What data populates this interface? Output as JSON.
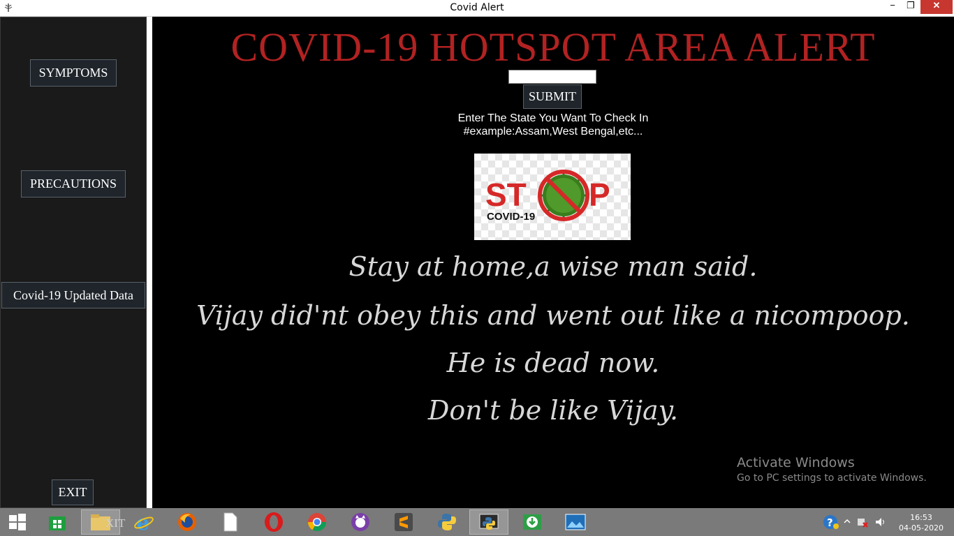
{
  "window": {
    "title": "Covid Alert",
    "minimize_glyph": "−",
    "maximize_glyph": "❐",
    "close_glyph": "✕"
  },
  "sidebar": {
    "symptoms": "SYMPTOMS",
    "precautions": "PRECAUTIONS",
    "updated_data": "Covid-19 Updated Data",
    "exit": "EXIT"
  },
  "main": {
    "heading": "COVID-19 HOTSPOT AREA ALERT",
    "state_input_value": "",
    "submit_label": "SUBMIT",
    "hint_line1": "Enter The State You Want To Check In",
    "hint_line2": "#example:Assam,West Bengal,etc...",
    "stop_image": {
      "word_left": "ST",
      "word_right": "P",
      "caption": "COVID-19"
    },
    "quote_lines": [
      "Stay at home,a wise man said.",
      "Vijay did'nt obey this and went out like a nicompoop.",
      "He is dead now.",
      "Don't be like Vijay."
    ]
  },
  "watermark": {
    "line1": "Activate Windows",
    "line2": "Go to PC settings to activate Windows."
  },
  "taskbar": {
    "apps": [
      "start-icon",
      "store-icon",
      "file-explorer-icon",
      "internet-explorer-icon",
      "firefox-icon",
      "file-icon",
      "opera-icon",
      "chrome-icon",
      "github-icon",
      "sublime-text-icon",
      "python-idle-icon",
      "python-icon",
      "download-icon",
      "photos-icon"
    ],
    "overlay_text": "XIT",
    "time": "16:53",
    "date": "04-05-2020"
  },
  "colors": {
    "heading": "#b22222",
    "panel_bg": "#000000",
    "sidebar_bg": "#1a1a1a",
    "button_bg": "#1f252b",
    "close_red": "#c7372f"
  }
}
